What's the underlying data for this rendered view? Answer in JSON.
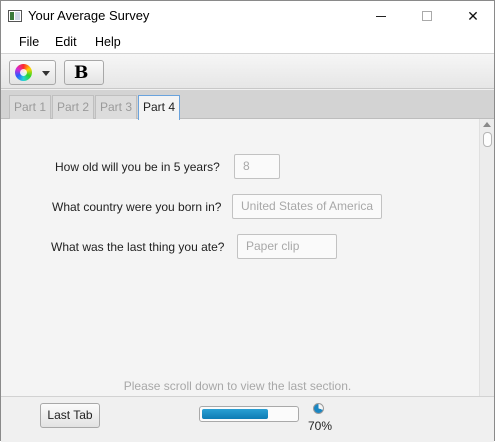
{
  "window": {
    "title": "Your Average Survey",
    "minimize_glyph": "",
    "maximize_glyph": "",
    "close_glyph": "✕"
  },
  "menu": {
    "items": [
      {
        "label": "File"
      },
      {
        "label": "Edit"
      },
      {
        "label": "Help"
      }
    ]
  },
  "toolbar": {
    "color_picker_icon": "color-wheel-icon",
    "bold_label": "B"
  },
  "tabs": [
    {
      "label": "Part 1",
      "active": false
    },
    {
      "label": "Part 2",
      "active": false
    },
    {
      "label": "Part 3",
      "active": false
    },
    {
      "label": "Part 4",
      "active": true
    }
  ],
  "questions": [
    {
      "label": "How old will you be in 5 years?",
      "placeholder": "8"
    },
    {
      "label": "What country were you born in?",
      "placeholder": "United States of America"
    },
    {
      "label": "What was the last thing you ate?",
      "placeholder": "Paper clip"
    }
  ],
  "hint": "Please scroll down to view the last section.",
  "footer": {
    "last_tab_label": "Last Tab",
    "progress_value": 0.7,
    "progress_text": "70%"
  },
  "colors": {
    "accent": "#1a86c2",
    "active_tab_border": "#6aa3dd"
  }
}
